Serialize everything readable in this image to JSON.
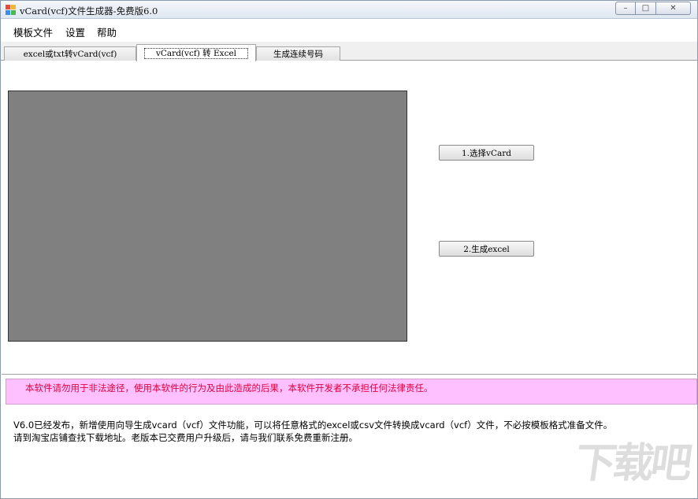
{
  "window": {
    "title": "vCard(vcf)文件生成器-免费版6.0",
    "controls": {
      "minimize": "–",
      "maximize": "□",
      "close": "✕"
    }
  },
  "menu": [
    {
      "label": "模板文件"
    },
    {
      "label": "设置"
    },
    {
      "label": "帮助"
    }
  ],
  "tabs": [
    {
      "label": "excel或txt转vCard(vcf)",
      "active": false
    },
    {
      "label": "vCard(vcf) 转 Excel",
      "active": true
    },
    {
      "label": "生成连续号码",
      "active": false
    }
  ],
  "panel": {
    "select_button": "1.选择vCard",
    "generate_button": "2.生成excel"
  },
  "warning": "本软件请勿用于非法途径，使用本软件的行为及由此造成的后果，本软件开发者不承担任何法律责任。",
  "info": {
    "line1": "V6.0已经发布，新增使用向导生成vcard（vcf）文件功能，可以将任意格式的excel或csv文件转换成vcard（vcf）文件，不必按模板格式准备文件。",
    "line2": "请到淘宝店铺查找下载地址。老版本已交费用户升级后，请与我们联系免费重新注册。"
  },
  "watermark": {
    "main": "下载吧"
  },
  "colors": {
    "warning_bg": "#ffc0ff",
    "warning_text": "#e0003c",
    "display_bg": "#808080"
  }
}
